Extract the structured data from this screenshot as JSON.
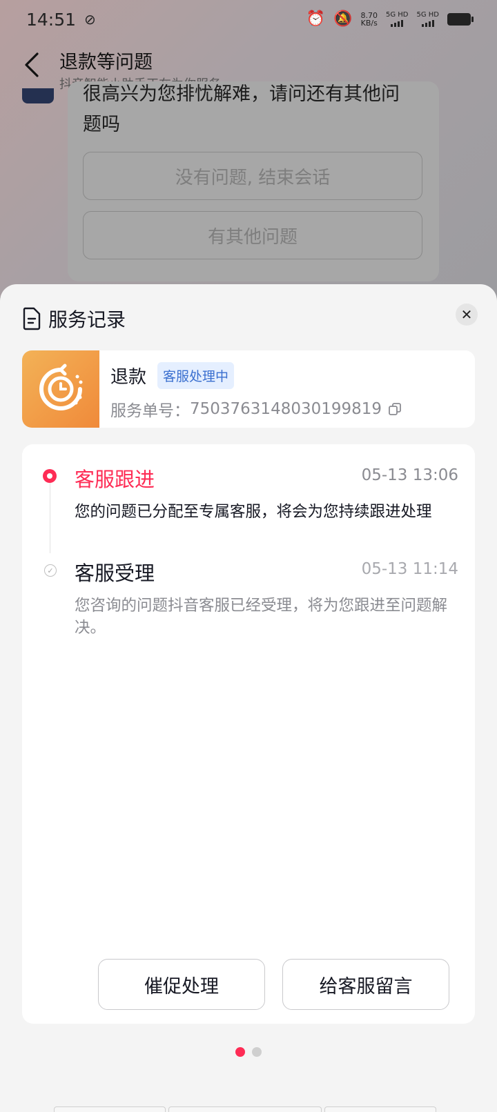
{
  "status_bar": {
    "time": "14:51",
    "net_speed_value": "8.70",
    "net_speed_unit": "KB/s",
    "sim1": "5G HD",
    "sim2": "5G HD"
  },
  "chat": {
    "title": "退款等问题",
    "subtitle": "抖音智能小助手正在为你服务",
    "bot_message_partial": "很高兴为您排忧解难，请问还有其他问",
    "bot_message_end": "题吗",
    "option_end": "没有问题, 结束会话",
    "option_other": "有其他问题"
  },
  "sheet": {
    "title": "服务记录",
    "close_icon": "close-icon"
  },
  "service": {
    "name": "退款",
    "status": "客服处理中",
    "order_label": "服务单号：",
    "order_number": "7503763148030199819"
  },
  "timeline": [
    {
      "title": "客服跟进",
      "time": "05-13 13:06",
      "desc": "您的问题已分配至专属客服，将会为您持续跟进处理",
      "active": true
    },
    {
      "title": "客服受理",
      "time": "05-13 11:14",
      "desc": "您咨询的问题抖音客服已经受理，将为您跟进至问题解决。",
      "active": false
    }
  ],
  "actions": {
    "urge": "催促处理",
    "message": "给客服留言"
  },
  "colors": {
    "accent": "#fe2c55",
    "badge_bg": "#e5efff",
    "badge_text": "#3a6fcf"
  },
  "pager": {
    "count": 2,
    "active_index": 0
  }
}
